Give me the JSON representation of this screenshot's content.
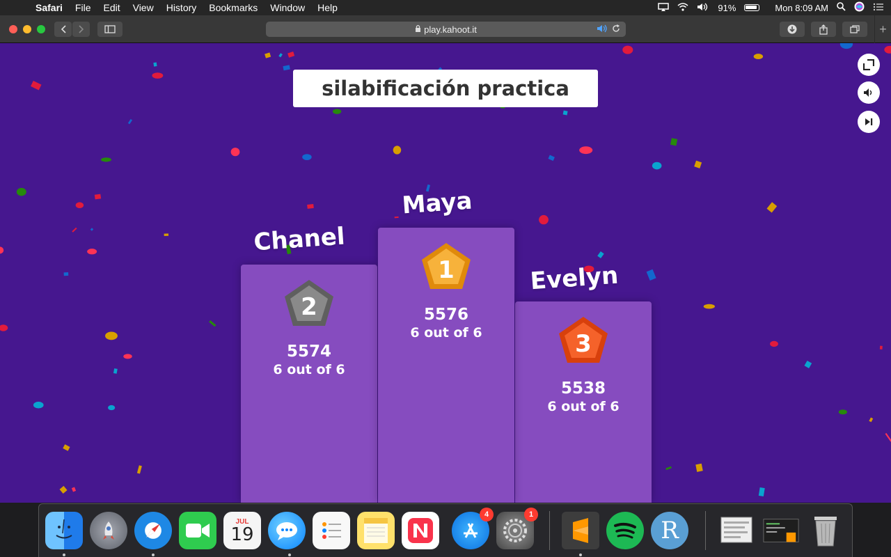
{
  "menubar": {
    "app": "Safari",
    "items": [
      "File",
      "Edit",
      "View",
      "History",
      "Bookmarks",
      "Window",
      "Help"
    ],
    "battery": "91%",
    "clock": "Mon 8:09 AM"
  },
  "browser": {
    "url": "play.kahoot.it"
  },
  "quiz": {
    "title": "silabificación practica"
  },
  "podium": [
    {
      "place": "1",
      "name": "Maya",
      "score": "5576",
      "correct": "6 out of 6",
      "medal_color": "#f5a623"
    },
    {
      "place": "2",
      "name": "Chanel",
      "score": "5574",
      "correct": "6 out of 6",
      "medal_color": "#7a7a7a"
    },
    {
      "place": "3",
      "name": "Evelyn",
      "score": "5538",
      "correct": "6 out of 6",
      "medal_color": "#f35a1e"
    }
  ],
  "controls": {
    "fullscreen_icon": "fullscreen-icon",
    "sound_icon": "volume-icon",
    "skip_icon": "skip-icon"
  },
  "dock": {
    "calendar_month": "JUL",
    "calendar_day": "19",
    "appstore_badge": "4",
    "settings_badge": "1",
    "r_label": "R"
  },
  "colors": {
    "page_bg": "#46178f",
    "podium_bg": "#864cbf"
  }
}
